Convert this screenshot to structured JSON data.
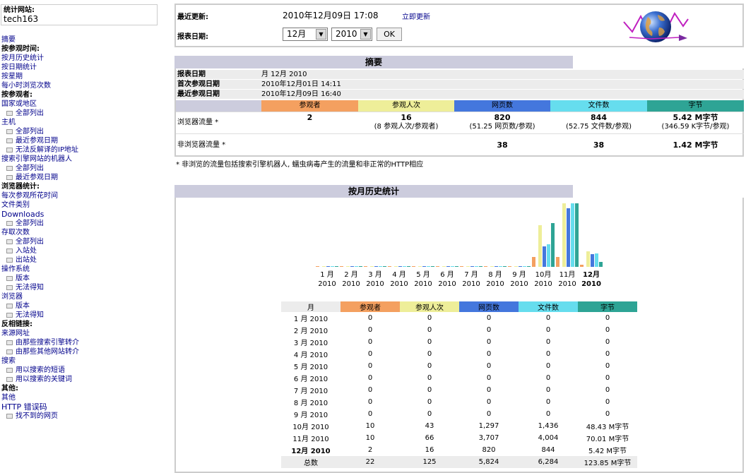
{
  "colors": {
    "visitors": "#f4a060",
    "visits": "#eeee99",
    "pages": "#4477dd",
    "hits": "#66ddee",
    "bandwidth": "#2ea495",
    "header_bg": "#ccccdd"
  },
  "sidebar": {
    "site_label": "统计网站:",
    "site_value": "tech163",
    "menu": [
      {
        "text": "摘要",
        "type": "link"
      },
      {
        "text": "按参观时间:",
        "type": "head"
      },
      {
        "text": "按月历史统计",
        "type": "link"
      },
      {
        "text": "按日期统计",
        "type": "link"
      },
      {
        "text": "按星期",
        "type": "link"
      },
      {
        "text": "每小时浏览次数",
        "type": "link"
      },
      {
        "text": "按参观者:",
        "type": "head"
      },
      {
        "text": "国家或地区",
        "type": "link"
      },
      {
        "text": "全部列出",
        "type": "sub"
      },
      {
        "text": "主机",
        "type": "link"
      },
      {
        "text": "全部列出",
        "type": "sub"
      },
      {
        "text": "最近参观日期",
        "type": "sub"
      },
      {
        "text": "无法反解译的IP地址",
        "type": "sub"
      },
      {
        "text": "搜索引擎网站的机器人",
        "type": "link"
      },
      {
        "text": "全部列出",
        "type": "sub"
      },
      {
        "text": "最近参观日期",
        "type": "sub"
      },
      {
        "text": "浏览器统计:",
        "type": "head"
      },
      {
        "text": "每次参观所花时间",
        "type": "link"
      },
      {
        "text": "文件类别",
        "type": "link"
      },
      {
        "text": "Downloads",
        "type": "linkbig"
      },
      {
        "text": "全部列出",
        "type": "sub"
      },
      {
        "text": "存取次数",
        "type": "link"
      },
      {
        "text": "全部列出",
        "type": "sub"
      },
      {
        "text": "入站处",
        "type": "sub"
      },
      {
        "text": "出站处",
        "type": "sub"
      },
      {
        "text": "操作系统",
        "type": "link"
      },
      {
        "text": "版本",
        "type": "sub"
      },
      {
        "text": "无法得知",
        "type": "sub"
      },
      {
        "text": "浏览器",
        "type": "link"
      },
      {
        "text": "版本",
        "type": "sub"
      },
      {
        "text": "无法得知",
        "type": "sub"
      },
      {
        "text": "反相链接:",
        "type": "head"
      },
      {
        "text": "来源网址",
        "type": "link"
      },
      {
        "text": "由那些搜索引擎转介",
        "type": "sub"
      },
      {
        "text": "由那些其他网站转介",
        "type": "sub"
      },
      {
        "text": "搜索",
        "type": "link"
      },
      {
        "text": "用以搜索的短语",
        "type": "sub"
      },
      {
        "text": "用以搜索的关键词",
        "type": "sub"
      },
      {
        "text": "其他:",
        "type": "head"
      },
      {
        "text": "其他",
        "type": "link"
      },
      {
        "text": "HTTP 错误码",
        "type": "linkbig"
      },
      {
        "text": "找不到的网页",
        "type": "sub"
      }
    ]
  },
  "top": {
    "last_update_label": "最近更新:",
    "last_update_value": "2010年12月09日 17:08",
    "update_now_link": "立即更新",
    "report_date_label": "报表日期:",
    "month_select": "12月",
    "year_select": "2010",
    "ok_label": "OK"
  },
  "summary": {
    "title": "摘要",
    "rows": [
      {
        "label": "报表日期",
        "value": "月 12月 2010"
      },
      {
        "label": "首次参观日期",
        "value": "2010年12月01日 14:11"
      },
      {
        "label": "最近参观日期",
        "value": "2010年12月09日 16:40"
      }
    ],
    "columns": [
      "参观者",
      "参观人次",
      "网页数",
      "文件数",
      "字节"
    ],
    "viewed_label": "浏览器流量 *",
    "viewed": [
      {
        "main": "2",
        "sub": ""
      },
      {
        "main": "16",
        "sub": "(8 参观人次/参观者)"
      },
      {
        "main": "820",
        "sub": "(51.25 网页数/参观)"
      },
      {
        "main": "844",
        "sub": "(52.75 文件数/参观)"
      },
      {
        "main": "5.42 M字节",
        "sub": "(346.59 K字节/参观)"
      }
    ],
    "notviewed_label": "非浏览器流量 *",
    "notviewed": [
      "",
      "",
      "38",
      "38",
      "1.42 M字节"
    ],
    "note": "* 非浏览的流量包括搜索引擎机器人, 蠕虫病毒产生的流量和非正常的HTTP相应"
  },
  "monthly": {
    "title": "按月历史统计",
    "table_headers": [
      "月",
      "参观者",
      "参观人次",
      "网页数",
      "文件数",
      "字节"
    ],
    "rows": [
      [
        "1 月 2010",
        "0",
        "0",
        "0",
        "0",
        "0"
      ],
      [
        "2 月 2010",
        "0",
        "0",
        "0",
        "0",
        "0"
      ],
      [
        "3 月 2010",
        "0",
        "0",
        "0",
        "0",
        "0"
      ],
      [
        "4 月 2010",
        "0",
        "0",
        "0",
        "0",
        "0"
      ],
      [
        "5 月 2010",
        "0",
        "0",
        "0",
        "0",
        "0"
      ],
      [
        "6 月 2010",
        "0",
        "0",
        "0",
        "0",
        "0"
      ],
      [
        "7 月 2010",
        "0",
        "0",
        "0",
        "0",
        "0"
      ],
      [
        "8 月 2010",
        "0",
        "0",
        "0",
        "0",
        "0"
      ],
      [
        "9 月 2010",
        "0",
        "0",
        "0",
        "0",
        "0"
      ],
      [
        "10月 2010",
        "10",
        "43",
        "1,297",
        "1,436",
        "48.43 M字节"
      ],
      [
        "11月 2010",
        "10",
        "66",
        "3,707",
        "4,004",
        "70.01 M字节"
      ],
      [
        "12月 2010",
        "2",
        "16",
        "820",
        "844",
        "5.42 M字节"
      ]
    ],
    "total": [
      "总数",
      "22",
      "125",
      "5,824",
      "6,284",
      "123.85 M字节"
    ]
  },
  "chart_data": {
    "type": "bar",
    "categories": [
      "1 月 2010",
      "2 月 2010",
      "3 月 2010",
      "4 月 2010",
      "5 月 2010",
      "6 月 2010",
      "7 月 2010",
      "8 月 2010",
      "9 月 2010",
      "10月 2010",
      "11月 2010",
      "12月 2010"
    ],
    "month_labels": [
      "1 月",
      "2 月",
      "3 月",
      "4 月",
      "5 月",
      "6 月",
      "7 月",
      "8 月",
      "9 月",
      "10月",
      "11月",
      "12月"
    ],
    "year_label": "2010",
    "series": [
      {
        "name": "参观者",
        "values": [
          0,
          0,
          0,
          0,
          0,
          0,
          0,
          0,
          0,
          10,
          10,
          2
        ]
      },
      {
        "name": "参观人次",
        "values": [
          0,
          0,
          0,
          0,
          0,
          0,
          0,
          0,
          0,
          43,
          66,
          16
        ]
      },
      {
        "name": "网页数",
        "values": [
          0,
          0,
          0,
          0,
          0,
          0,
          0,
          0,
          0,
          1297,
          3707,
          820
        ]
      },
      {
        "name": "文件数",
        "values": [
          0,
          0,
          0,
          0,
          0,
          0,
          0,
          0,
          0,
          1436,
          4004,
          844
        ]
      },
      {
        "name": "字节",
        "values": [
          0,
          0,
          0,
          0,
          0,
          0,
          0,
          0,
          0,
          48.43,
          70.01,
          5.42
        ]
      }
    ]
  }
}
